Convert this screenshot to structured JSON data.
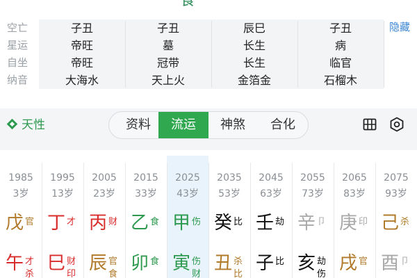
{
  "top_char": "食",
  "hide_label": "隐藏",
  "info_rows": [
    {
      "label": "空亡",
      "cells": [
        "子丑",
        "子丑",
        "辰巳",
        "子丑"
      ]
    },
    {
      "label": "星运",
      "cells": [
        "帝旺",
        "墓",
        "长生",
        "病"
      ]
    },
    {
      "label": "自坐",
      "cells": [
        "帝旺",
        "冠带",
        "长生",
        "临官"
      ]
    },
    {
      "label": "纳音",
      "cells": [
        "大海水",
        "天上火",
        "金箔金",
        "石榴木"
      ]
    }
  ],
  "tianxing_label": "天性",
  "tabs": [
    "资料",
    "流运",
    "神煞",
    "合化"
  ],
  "active_tab": "流运",
  "icons": {
    "grid": "grid-icon",
    "settings": "gear-icon",
    "tianxing": "diamond-icon"
  },
  "colors": {
    "wood": "#2e9a50",
    "fire": "#d92c2c",
    "earth": "#b07a2a",
    "water": "#111111",
    "metal": "#a8a8a8",
    "accent": "#2fa84f",
    "link": "#3b87d6"
  },
  "luck": [
    {
      "year": "1985",
      "age": "3岁",
      "stem": "戊",
      "stem_color": "#b07a2a",
      "stem_god": "官",
      "branch": "午",
      "branch_color": "#d92c2c",
      "branch_gods": [
        "才",
        "杀"
      ]
    },
    {
      "year": "1995",
      "age": "13岁",
      "stem": "丁",
      "stem_color": "#d92c2c",
      "stem_god": "才",
      "branch": "巳",
      "branch_color": "#d92c2c",
      "branch_gods": [
        "财",
        "印"
      ]
    },
    {
      "year": "2005",
      "age": "23岁",
      "stem": "丙",
      "stem_color": "#d92c2c",
      "stem_god": "财",
      "branch": "辰",
      "branch_color": "#b07a2a",
      "branch_gods": [
        "官",
        "食"
      ]
    },
    {
      "year": "2015",
      "age": "33岁",
      "stem": "乙",
      "stem_color": "#2e9a50",
      "stem_god": "食",
      "branch": "卯",
      "branch_color": "#2e9a50",
      "branch_gods": [
        "食",
        ""
      ]
    },
    {
      "year": "2025",
      "age": "43岁",
      "stem": "甲",
      "stem_color": "#2e9a50",
      "stem_god": "伤",
      "branch": "寅",
      "branch_color": "#2e9a50",
      "branch_gods": [
        "伤",
        "财"
      ]
    },
    {
      "year": "2035",
      "age": "53岁",
      "stem": "癸",
      "stem_color": "#111111",
      "stem_god": "比",
      "branch": "丑",
      "branch_color": "#b07a2a",
      "branch_gods": [
        "杀",
        "比"
      ]
    },
    {
      "year": "2045",
      "age": "63岁",
      "stem": "壬",
      "stem_color": "#111111",
      "stem_god": "劫",
      "branch": "子",
      "branch_color": "#111111",
      "branch_gods": [
        "比",
        ""
      ]
    },
    {
      "year": "2055",
      "age": "73岁",
      "stem": "辛",
      "stem_color": "#a8a8a8",
      "stem_god": "卩",
      "branch": "亥",
      "branch_color": "#111111",
      "branch_gods": [
        "劫",
        "伤"
      ]
    },
    {
      "year": "2065",
      "age": "83岁",
      "stem": "庚",
      "stem_color": "#a8a8a8",
      "stem_god": "印",
      "branch": "戌",
      "branch_color": "#b07a2a",
      "branch_gods": [
        "官",
        ""
      ]
    },
    {
      "year": "2075",
      "age": "93岁",
      "stem": "己",
      "stem_color": "#b07a2a",
      "stem_god": "杀",
      "branch": "酉",
      "branch_color": "#a8a8a8",
      "branch_gods": [
        "卩",
        ""
      ]
    }
  ],
  "active_luck_year": "2025"
}
